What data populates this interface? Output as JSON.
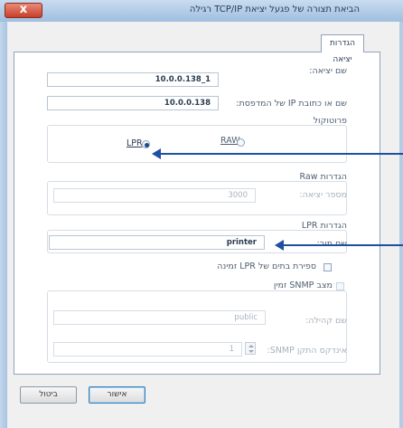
{
  "window": {
    "title": "הביאת תצורה של פגעל יציאת TCP/IP רגילה",
    "close_glyph": "x"
  },
  "tab": {
    "label": "הגדרות יציאה"
  },
  "port_name": {
    "label": "שם יציאה:",
    "value": "10.0.0.138_1"
  },
  "printer_address": {
    "label": "שם או כתובת IP של המדפסת:",
    "value": "10.0.0.138"
  },
  "protocol": {
    "label": "פרוטוקול",
    "raw_label": "RAW",
    "lpr_label": "LPR",
    "selected": "LPR"
  },
  "raw_settings": {
    "label": "הגדרות Raw",
    "port_number_label": "מספר יציאה:",
    "port_number_value": "3000"
  },
  "lpr_settings": {
    "label": "הגדרות LPR",
    "queue_name_label": "שם תור:",
    "queue_name_value": "printer",
    "byte_counting_label": "ספירת בתים של LPR זמינה"
  },
  "snmp": {
    "status_label": "מצב SNMP זמין",
    "community_label": "שם קהילה:",
    "community_value": "public",
    "device_index_label": "אינדקס התקן SNMP:",
    "device_index_value": "1"
  },
  "buttons": {
    "ok": "אישור",
    "cancel": "ביטול"
  },
  "colors": {
    "annotation_arrow": "#1f4fa3",
    "selected_radio": "#1f4b8e"
  }
}
